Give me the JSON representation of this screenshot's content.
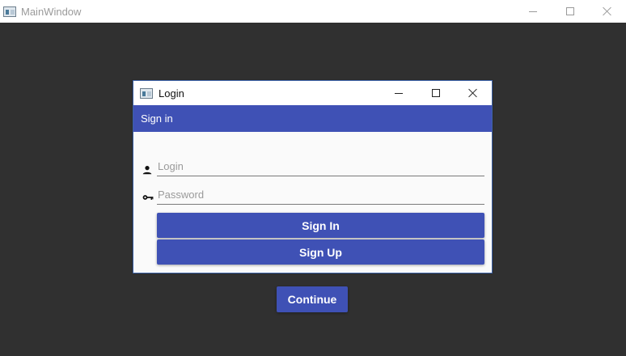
{
  "main_window": {
    "title": "MainWindow",
    "continue_label": "Continue"
  },
  "login_dialog": {
    "title": "Login",
    "header": "Sign in",
    "login_placeholder": "Login",
    "password_placeholder": "Password",
    "sign_in_label": "Sign In",
    "sign_up_label": "Sign Up"
  },
  "colors": {
    "primary": "#3f51b5",
    "background": "#303030",
    "dialog_surface": "#fafafa"
  },
  "icons": [
    "app-icon",
    "minimize-icon",
    "maximize-icon",
    "close-icon",
    "user-icon",
    "key-icon"
  ]
}
